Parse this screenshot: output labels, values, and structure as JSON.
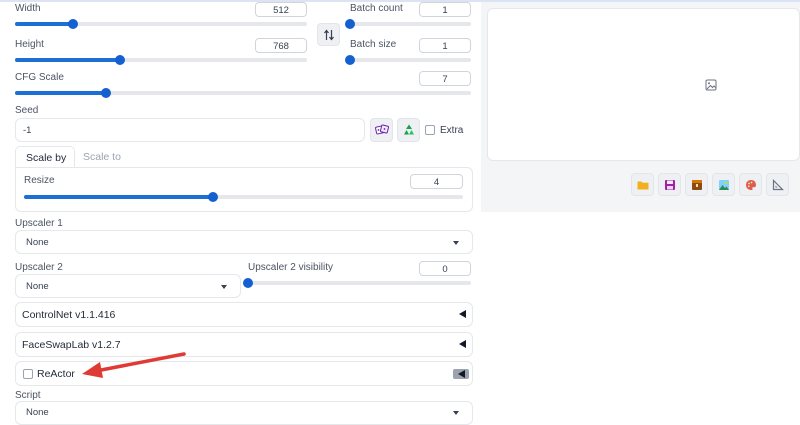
{
  "width": {
    "label": "Width",
    "value": "512",
    "level": 0.2
  },
  "height": {
    "label": "Height",
    "value": "768",
    "level": 0.36
  },
  "swap_icon": "swap-vertical-arrows-icon",
  "batch_count": {
    "label": "Batch count",
    "value": "1",
    "level": 0.0
  },
  "batch_size": {
    "label": "Batch size",
    "value": "1",
    "level": 0.0
  },
  "cfg_scale": {
    "label": "CFG Scale",
    "value": "7",
    "level": 0.2
  },
  "seed": {
    "label": "Seed",
    "value": "-1",
    "dice_icon": "dice-icon",
    "recycle_icon": "recycle-icon",
    "extra_label": "Extra"
  },
  "tabs": [
    {
      "label": "Scale by",
      "active": true
    },
    {
      "label": "Scale to",
      "active": false
    }
  ],
  "resize": {
    "label": "Resize",
    "value": "4",
    "level": 0.43
  },
  "upscaler1": {
    "label": "Upscaler 1",
    "value": "None"
  },
  "upscaler2": {
    "label": "Upscaler 2",
    "value": "None"
  },
  "upscaler2_visibility": {
    "label": "Upscaler 2 visibility",
    "value": "0",
    "level": 0.0
  },
  "accordions": [
    {
      "title": "ControlNet v1.1.416"
    },
    {
      "title": "FaceSwapLab v1.2.7"
    },
    {
      "title": "ReActor"
    }
  ],
  "script": {
    "label": "Script",
    "value": "None"
  },
  "output": {
    "placeholder_icon": "image-icon",
    "buttons": [
      {
        "name": "folder-icon",
        "color": "#f2b01e"
      },
      {
        "name": "save-icon",
        "color": "#a3219e"
      },
      {
        "name": "zip-icon",
        "color": "#8a4b16"
      },
      {
        "name": "image-icon",
        "color": "#2e8b57"
      },
      {
        "name": "palette-icon",
        "color": "#e15d4a"
      },
      {
        "name": "ruler-triangle-icon",
        "color": "#6b7280"
      }
    ]
  },
  "arrow_color": "#e03a34",
  "accent_color": "#1d6fd6"
}
